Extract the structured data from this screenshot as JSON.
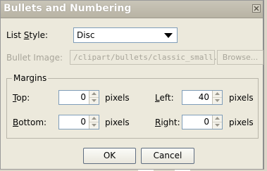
{
  "window": {
    "title": "Bullets and Numbering"
  },
  "list_style": {
    "label_pre": "List ",
    "label_key": "S",
    "label_post": "tyle:",
    "value": "Disc"
  },
  "bullet_image": {
    "label": "Bullet Image:",
    "value": "/clipart/bullets/classic_small.gif",
    "browse_label": "Browse..."
  },
  "margins": {
    "legend": "Margins",
    "top": {
      "key": "T",
      "rest": "op:",
      "value": "0",
      "unit": "pixels"
    },
    "bottom": {
      "key": "B",
      "rest": "ottom:",
      "value": "0",
      "unit": "pixels"
    },
    "left": {
      "key": "L",
      "rest": "eft:",
      "value": "40",
      "unit": "pixels"
    },
    "right": {
      "key": "R",
      "rest": "ight:",
      "value": "0",
      "unit": "pixels"
    }
  },
  "buttons": {
    "ok": "OK",
    "cancel": "Cancel"
  },
  "icons": {
    "close": "close-icon",
    "dropdown": "dropdown-arrow-icon",
    "spin_up": "spin-up-icon",
    "spin_down": "spin-down-icon"
  }
}
